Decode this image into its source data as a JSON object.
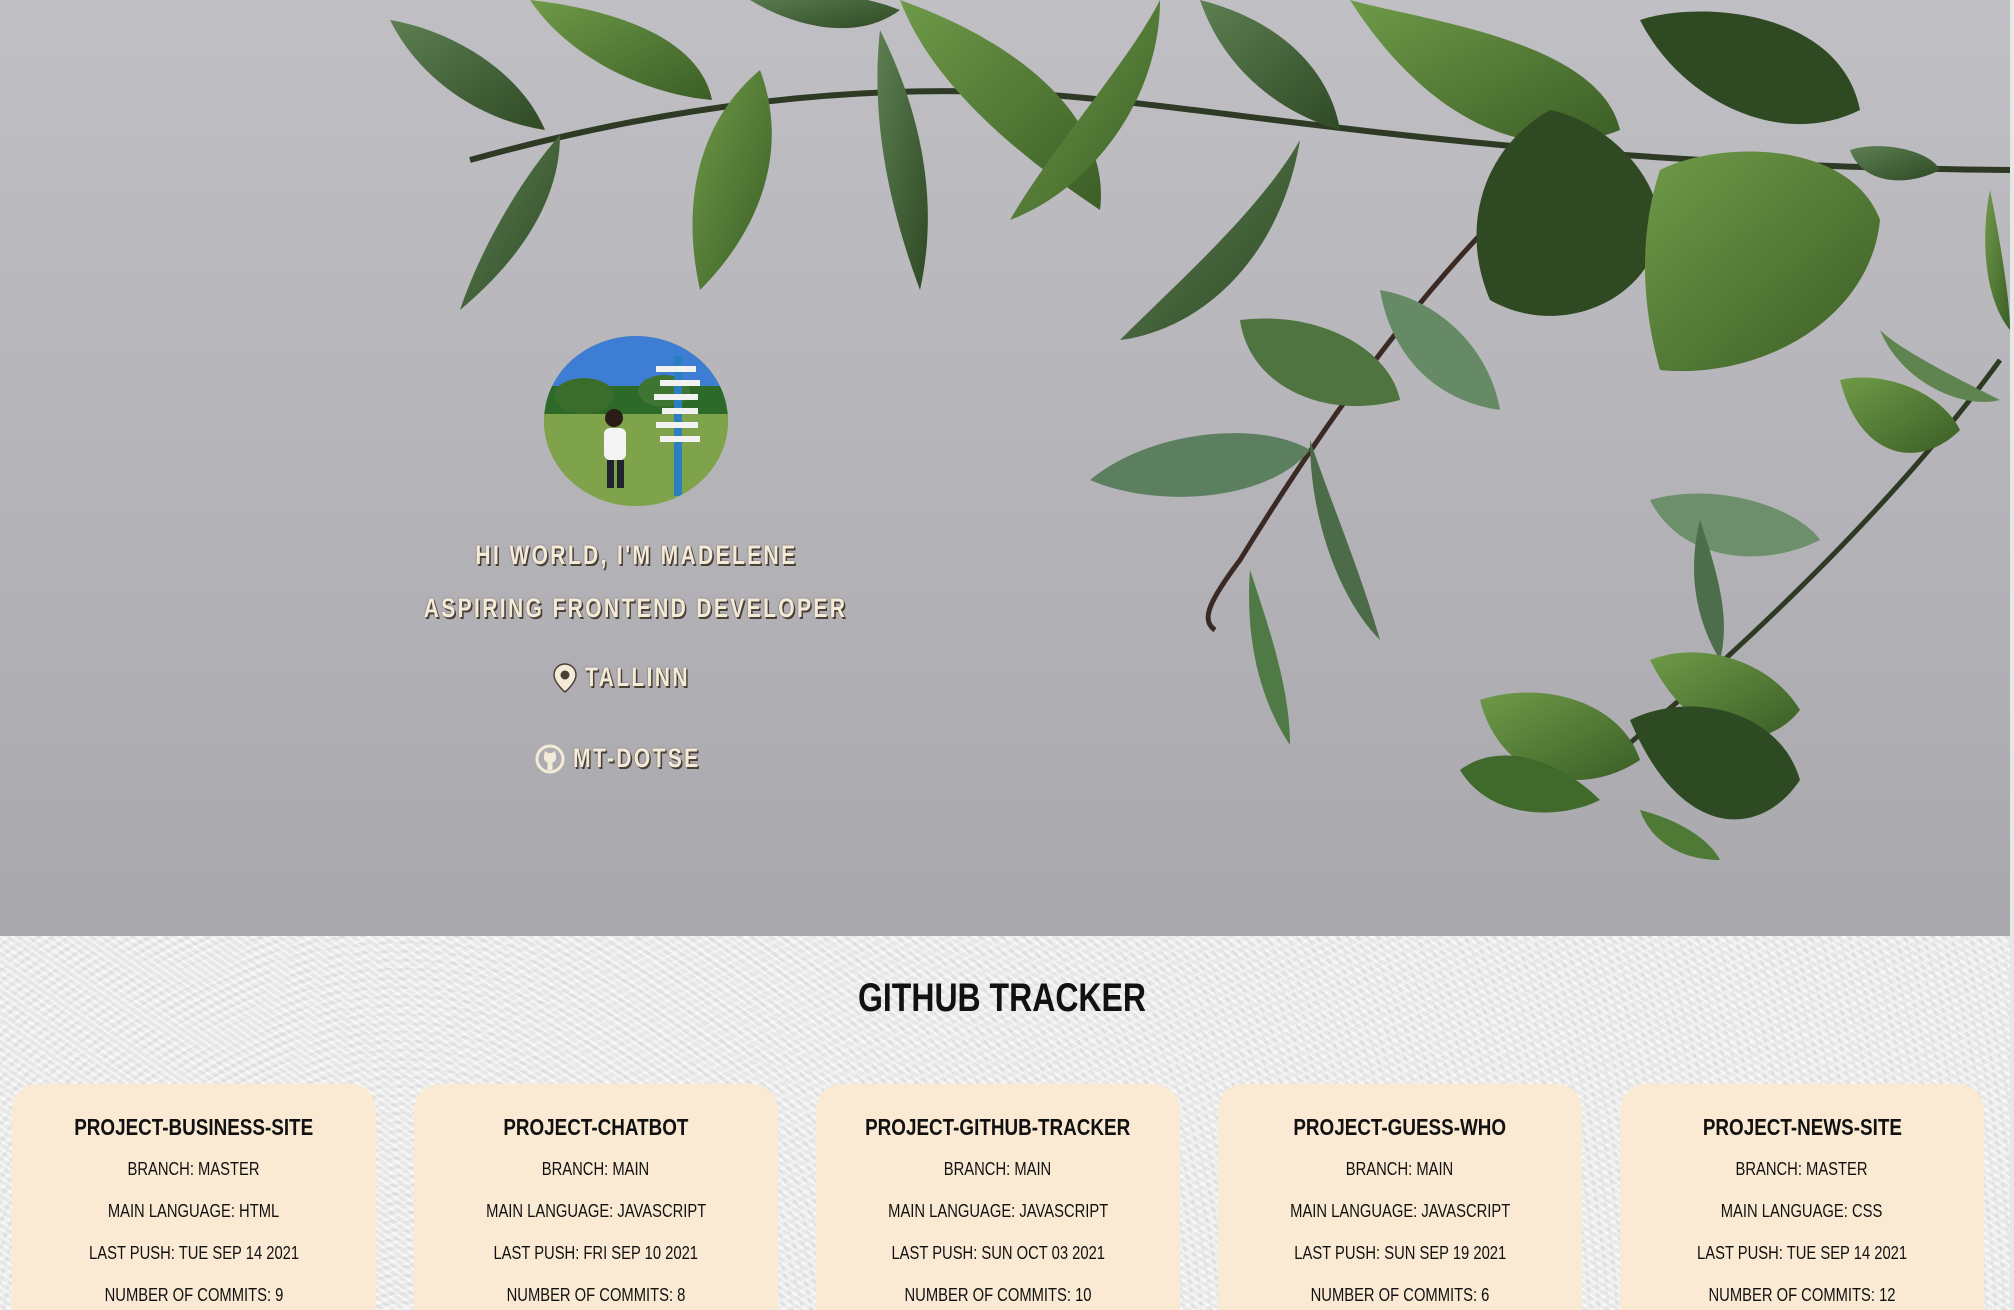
{
  "profile": {
    "greeting": "HI WORLD, I'M MADELENE",
    "role": "ASPIRING FRONTEND DEVELOPER",
    "location": "TALLINN",
    "github_user": "MT-DOTSE"
  },
  "tracker": {
    "title": "GITHUB TRACKER",
    "projects": [
      {
        "name": "PROJECT-BUSINESS-SITE",
        "branch": "BRANCH: MASTER",
        "language": "MAIN LANGUAGE: HTML",
        "last_push": "LAST PUSH: TUE SEP 14 2021",
        "commits": "NUMBER OF COMMITS: 9"
      },
      {
        "name": "PROJECT-CHATBOT",
        "branch": "BRANCH: MAIN",
        "language": "MAIN LANGUAGE: JAVASCRIPT",
        "last_push": "LAST PUSH: FRI SEP 10 2021",
        "commits": "NUMBER OF COMMITS: 8"
      },
      {
        "name": "PROJECT-GITHUB-TRACKER",
        "branch": "BRANCH: MAIN",
        "language": "MAIN LANGUAGE: JAVASCRIPT",
        "last_push": "LAST PUSH: SUN OCT 03 2021",
        "commits": "NUMBER OF COMMITS: 10"
      },
      {
        "name": "PROJECT-GUESS-WHO",
        "branch": "BRANCH: MAIN",
        "language": "MAIN LANGUAGE: JAVASCRIPT",
        "last_push": "LAST PUSH: SUN SEP 19 2021",
        "commits": "NUMBER OF COMMITS: 6"
      },
      {
        "name": "PROJECT-NEWS-SITE",
        "branch": "BRANCH: MASTER",
        "language": "MAIN LANGUAGE: CSS",
        "last_push": "LAST PUSH: TUE SEP 14 2021",
        "commits": "NUMBER OF COMMITS: 12"
      }
    ]
  },
  "icons": {
    "location": "map-pin-icon",
    "github": "github-icon"
  },
  "colors": {
    "hero_text": "#f4ead8",
    "card_background": "#fbead3",
    "leaf_green": "#4f7a32"
  }
}
